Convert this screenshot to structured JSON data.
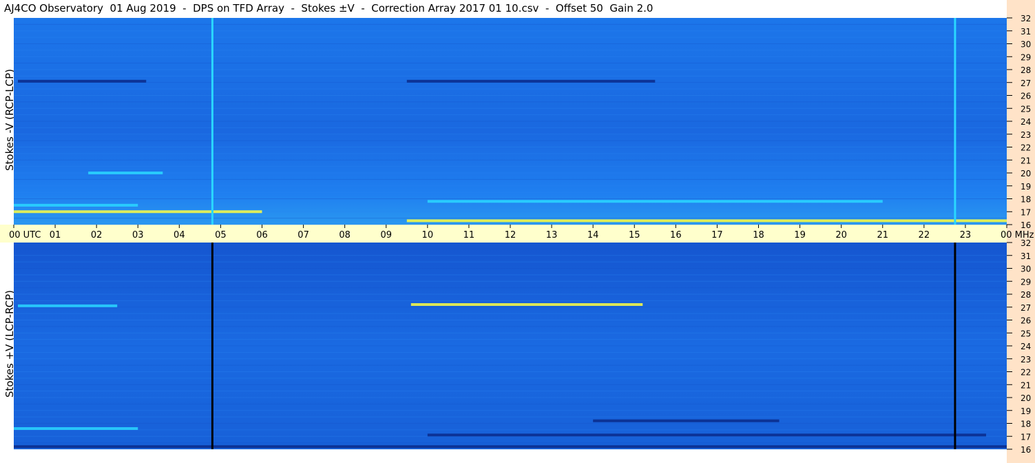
{
  "title": "AJ4CO Observatory  01 Aug 2019  -  DPS on TFD Array  -  Stokes ±V  -  Correction Array 2017 01 10.csv  -  Offset 50  Gain 2.0",
  "colors": {
    "background_blue": "#1a6fe6",
    "dark_band": "#0a2a8a",
    "bright_band": "#2ad7ff",
    "hot_band": "#ffff40",
    "time_bar": "#ffffcc",
    "freq_scale": "#ffe3c8"
  },
  "chart_data": [
    {
      "type": "heatmap",
      "panel": "top",
      "ylabel": "Stokes -V (RCP-LCP)",
      "y_unit": "MHz",
      "yticks": [
        16,
        17,
        18,
        19,
        20,
        21,
        22,
        23,
        24,
        25,
        26,
        27,
        28,
        29,
        30,
        31,
        32
      ],
      "ylim": [
        16,
        32
      ],
      "xlim": [
        0,
        24
      ],
      "vertical_lines": [
        {
          "time_utc": 4.8,
          "color": "#2ad7ff"
        },
        {
          "time_utc": 22.75,
          "color": "#2ad7ff"
        }
      ],
      "features": [
        {
          "from_utc": 9.5,
          "to_utc": 15.5,
          "freq_mhz": 27.1,
          "level": "dark"
        },
        {
          "from_utc": 0.1,
          "to_utc": 3.2,
          "freq_mhz": 27.1,
          "level": "dark"
        },
        {
          "from_utc": 0.0,
          "to_utc": 6.0,
          "freq_mhz": 17.0,
          "level": "hot"
        },
        {
          "from_utc": 9.5,
          "to_utc": 24.0,
          "freq_mhz": 16.3,
          "level": "hot"
        },
        {
          "from_utc": 0.0,
          "to_utc": 3.0,
          "freq_mhz": 17.5,
          "level": "bright"
        },
        {
          "from_utc": 10.0,
          "to_utc": 21.0,
          "freq_mhz": 17.8,
          "level": "bright"
        },
        {
          "from_utc": 1.8,
          "to_utc": 3.6,
          "freq_mhz": 20.0,
          "level": "bright"
        }
      ]
    },
    {
      "type": "heatmap",
      "panel": "bottom",
      "ylabel": "Stokes +V (LCP-RCP)",
      "y_unit": "MHz",
      "yticks": [
        16,
        17,
        18,
        19,
        20,
        21,
        22,
        23,
        24,
        25,
        26,
        27,
        28,
        29,
        30,
        31,
        32
      ],
      "ylim": [
        16,
        32
      ],
      "xlim": [
        0,
        24
      ],
      "vertical_lines": [
        {
          "time_utc": 4.8,
          "color": "#000000"
        },
        {
          "time_utc": 22.75,
          "color": "#000000"
        }
      ],
      "features": [
        {
          "from_utc": 9.6,
          "to_utc": 15.2,
          "freq_mhz": 27.2,
          "level": "hot"
        },
        {
          "from_utc": 0.1,
          "to_utc": 2.5,
          "freq_mhz": 27.1,
          "level": "bright"
        },
        {
          "from_utc": 0.0,
          "to_utc": 24.0,
          "freq_mhz": 16.2,
          "level": "dark"
        },
        {
          "from_utc": 10.0,
          "to_utc": 23.5,
          "freq_mhz": 17.1,
          "level": "dark"
        },
        {
          "from_utc": 14.0,
          "to_utc": 18.5,
          "freq_mhz": 18.2,
          "level": "dark"
        },
        {
          "from_utc": 0.0,
          "to_utc": 3.0,
          "freq_mhz": 17.6,
          "level": "bright"
        }
      ]
    }
  ],
  "time_axis": {
    "labels": [
      "00 UTC",
      "01",
      "02",
      "03",
      "04",
      "05",
      "06",
      "07",
      "08",
      "09",
      "10",
      "11",
      "12",
      "13",
      "14",
      "15",
      "16",
      "17",
      "18",
      "19",
      "20",
      "21",
      "22",
      "23",
      "00 MHz"
    ],
    "hours": [
      0,
      1,
      2,
      3,
      4,
      5,
      6,
      7,
      8,
      9,
      10,
      11,
      12,
      13,
      14,
      15,
      16,
      17,
      18,
      19,
      20,
      21,
      22,
      23,
      24
    ]
  }
}
